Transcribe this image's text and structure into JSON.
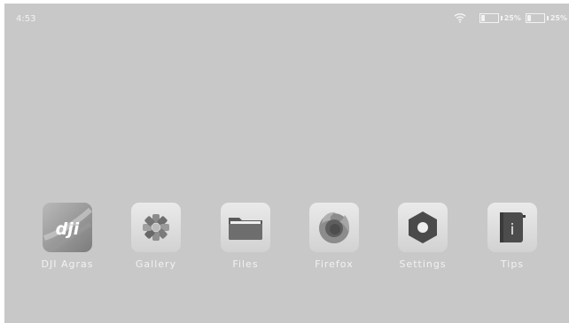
{
  "status_bar": {
    "time": "4:53",
    "battery_1_percent": "25%",
    "battery_1_level": 0.25,
    "battery_2_percent": "25%",
    "battery_2_level": 0.25,
    "wifi_icon": "wifi-icon"
  },
  "apps": [
    {
      "label": "DJI Agras",
      "icon": "dji-agras-icon"
    },
    {
      "label": "Gallery",
      "icon": "gallery-icon"
    },
    {
      "label": "Files",
      "icon": "folder-icon"
    },
    {
      "label": "Firefox",
      "icon": "firefox-icon"
    },
    {
      "label": "Settings",
      "icon": "settings-icon"
    },
    {
      "label": "Tips",
      "icon": "tips-icon"
    }
  ],
  "colors": {
    "background": "#c8c8c8",
    "text": "#f2f2f2",
    "icon_tile": "#e6e6e6",
    "icon_dark": "#555555"
  }
}
